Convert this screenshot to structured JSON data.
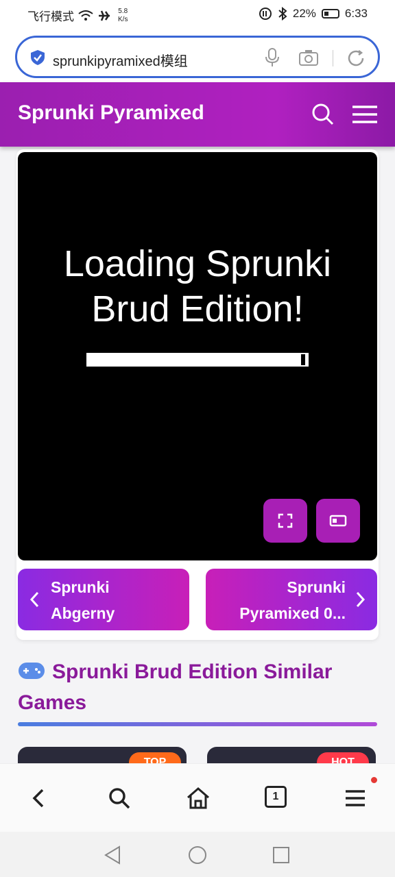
{
  "status_bar": {
    "left_text": "飞行模式",
    "net_speed_value": "5.8",
    "net_speed_unit": "K/s",
    "battery": "22%",
    "time": "6:33"
  },
  "address_bar": {
    "query": "sprunkipyramixed模组"
  },
  "header": {
    "site_title": "Sprunki Pyramixed"
  },
  "game": {
    "loading_line1": "Loading Sprunki",
    "loading_line2": "Brud Edition!",
    "progress": 0.99
  },
  "navigation": {
    "prev_label_1": "Sprunki",
    "prev_label_2": "Abgerny",
    "next_label_1": "Sprunki",
    "next_label_2": "Pyramixed 0..."
  },
  "similar": {
    "heading": "Sprunki Brud Edition Similar Games",
    "badges": [
      "TOP",
      "HOT"
    ]
  },
  "colors": {
    "brand_purple": "#a81fb5",
    "heading_purple": "#8a1a9a",
    "address_border": "#3a66d6"
  },
  "toolbar": {
    "tab_count": "1"
  }
}
